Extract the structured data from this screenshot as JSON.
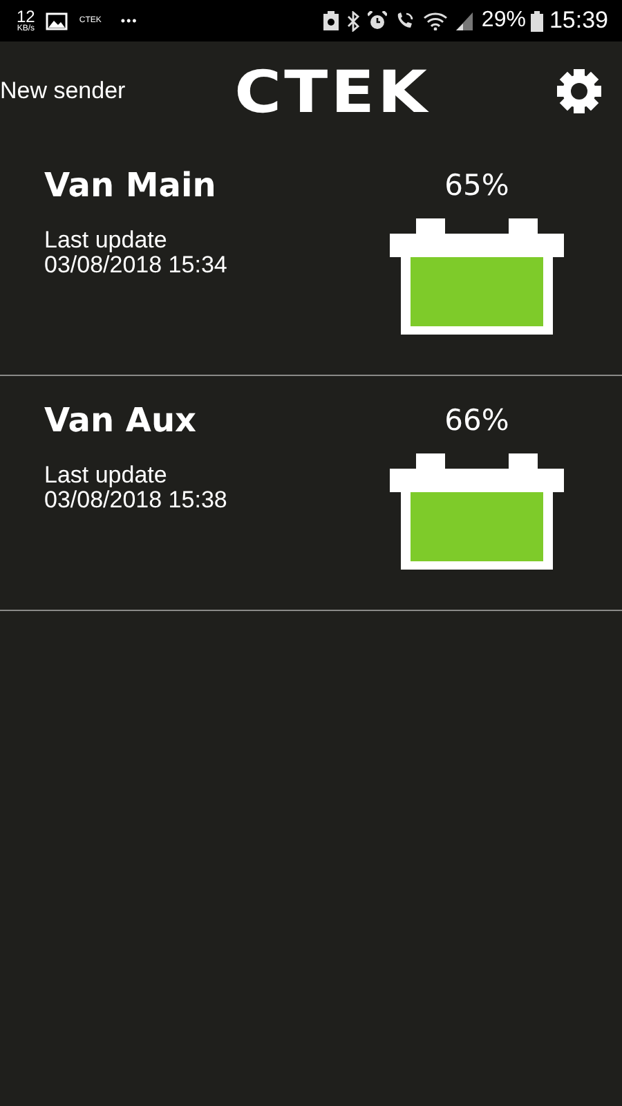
{
  "status_bar": {
    "speed": "12",
    "speed_unit": "KB/s",
    "app_label": "CTEK",
    "more": "•••",
    "battery": "29%",
    "time": "15:39"
  },
  "header": {
    "left_action": "New sender",
    "logo": "CTEK"
  },
  "batteries": [
    {
      "name": "Van Main",
      "percent": "65%",
      "update_label": "Last update",
      "update_time": "03/08/2018 15:34"
    },
    {
      "name": "Van Aux",
      "percent": "66%",
      "update_label": "Last update",
      "update_time": "03/08/2018 15:38"
    }
  ]
}
